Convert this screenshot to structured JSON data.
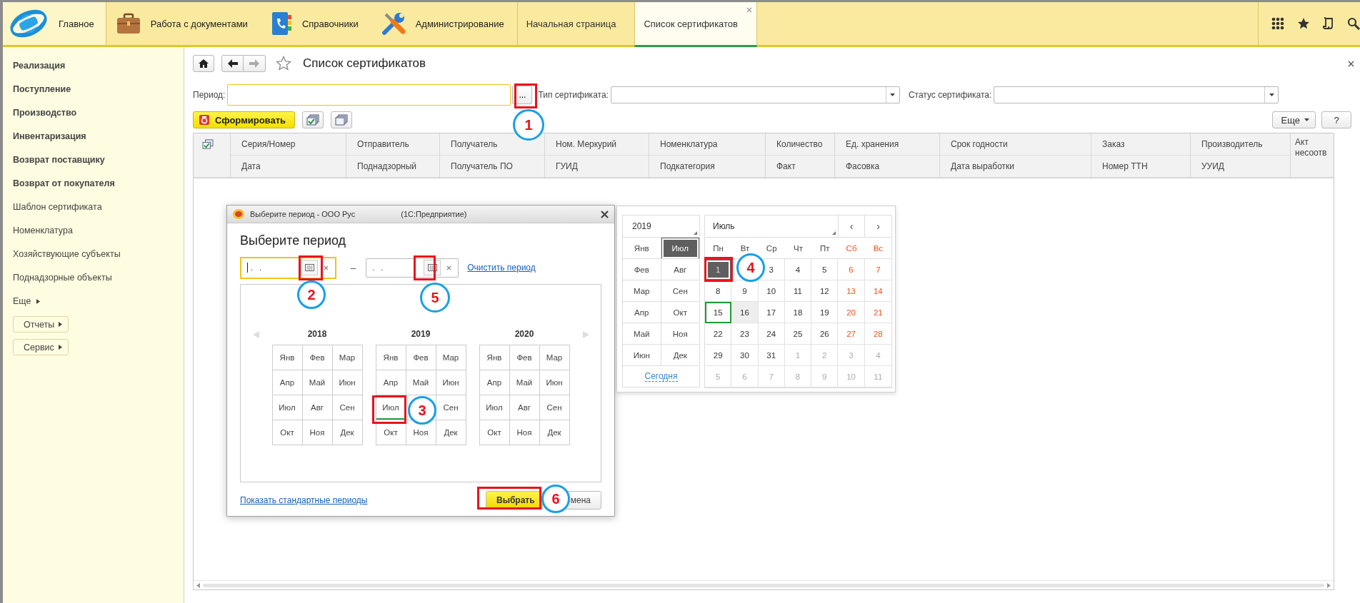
{
  "sections": [
    {
      "label": "Главное",
      "kind": "logo",
      "selected": true
    },
    {
      "label": "Работа с документами",
      "kind": "briefcase",
      "selected": false
    },
    {
      "label": "Справочники",
      "kind": "phonebook",
      "selected": false
    },
    {
      "label": "Администрирование",
      "kind": "tools",
      "selected": false
    }
  ],
  "open_tabs": [
    {
      "label": "Начальная страница",
      "selected": false,
      "closable": false
    },
    {
      "label": "Список сертификатов",
      "selected": true,
      "closable": true
    }
  ],
  "sidebar": {
    "items": [
      {
        "label": "Реализация",
        "bold": true
      },
      {
        "label": "Поступление",
        "bold": true
      },
      {
        "label": "Производство",
        "bold": true
      },
      {
        "label": "Инвентаризация",
        "bold": true
      },
      {
        "label": "Возврат поставщику",
        "bold": true
      },
      {
        "label": "Возврат от покупателя",
        "bold": true
      },
      {
        "label": "Шаблон сертификата",
        "bold": false
      },
      {
        "label": "Номенклатура",
        "bold": false
      },
      {
        "label": "Хозяйствующие субъекты",
        "bold": false
      },
      {
        "label": "Поднадзорные объекты",
        "bold": false
      }
    ],
    "more": "Еще",
    "buttons": [
      "Отчеты",
      "Сервис"
    ]
  },
  "page": {
    "title": "Список сертификатов",
    "filters": [
      {
        "label": "Период:",
        "kind": "period",
        "focused": true,
        "button": "..."
      },
      {
        "label": "Тип сертификата:",
        "kind": "dropdown",
        "focused": false
      },
      {
        "label": "Статус сертификата:",
        "kind": "dropdown",
        "focused": false
      }
    ],
    "generate": "Сформировать",
    "more": "Еще",
    "help": "?",
    "columns": [
      {
        "top": "Серия/Номер",
        "bottom": "Дата"
      },
      {
        "top": "Отправитель",
        "bottom": "Поднадзорный"
      },
      {
        "top": "Получатель",
        "bottom": "Получатель ПО"
      },
      {
        "top": "Ном. Меркурий",
        "bottom": "ГУИД"
      },
      {
        "top": "Номенклатура",
        "bottom": "Подкатегория"
      },
      {
        "top": "Количество",
        "bottom": "Факт"
      },
      {
        "top": "Ед. хранения",
        "bottom": "Фасовка"
      },
      {
        "top": "Срок годности",
        "bottom": "Дата выработки"
      },
      {
        "top": "Заказ",
        "bottom": "Номер ТТН"
      },
      {
        "top": "Производитель",
        "bottom": "УУИД"
      },
      {
        "top": "Акт несоотв"
      }
    ]
  },
  "period_dialog": {
    "window_title": "Выберите период - ООО Рус",
    "app_name": "(1С:Предприятие)",
    "heading": "Выберите период",
    "fields": [
      {
        "value": ". .",
        "focused": true
      },
      {
        "value": ". .",
        "focused": false
      }
    ],
    "dash": "–",
    "clear_link": "Очистить период",
    "years": [
      {
        "year": "2018",
        "months": [
          {
            "label": "Янв",
            "current": false
          },
          {
            "label": "Фев",
            "current": false
          },
          {
            "label": "Мар",
            "current": false
          },
          {
            "label": "Апр",
            "current": false
          },
          {
            "label": "Май",
            "current": false
          },
          {
            "label": "Июн",
            "current": false
          },
          {
            "label": "Июл",
            "current": false
          },
          {
            "label": "Авг",
            "current": false
          },
          {
            "label": "Сен",
            "current": false
          },
          {
            "label": "Окт",
            "current": false
          },
          {
            "label": "Ноя",
            "current": false
          },
          {
            "label": "Дек",
            "current": false
          }
        ]
      },
      {
        "year": "2019",
        "months": [
          {
            "label": "Янв",
            "current": false
          },
          {
            "label": "Фев",
            "current": false
          },
          {
            "label": "Мар",
            "current": false
          },
          {
            "label": "Апр",
            "current": false
          },
          {
            "label": "Май",
            "current": false
          },
          {
            "label": "Июн",
            "current": false
          },
          {
            "label": "Июл",
            "current": true
          },
          {
            "current": false
          },
          {
            "label": "Сен",
            "current": false
          },
          {
            "label": "Окт",
            "current": false
          },
          {
            "label": "Ноя",
            "current": false
          },
          {
            "label": "Дек",
            "current": false
          }
        ]
      },
      {
        "year": "2020",
        "months": [
          {
            "label": "Янв",
            "current": false
          },
          {
            "label": "Фев",
            "current": false
          },
          {
            "label": "Мар",
            "current": false
          },
          {
            "label": "Апр",
            "current": false
          },
          {
            "label": "Май",
            "current": false
          },
          {
            "label": "Июн",
            "current": false
          },
          {
            "label": "Июл",
            "current": false
          },
          {
            "label": "Авг",
            "current": false
          },
          {
            "label": "Сен",
            "current": false
          },
          {
            "label": "Окт",
            "current": false
          },
          {
            "label": "Ноя",
            "current": false
          },
          {
            "label": "Дек",
            "current": false
          }
        ]
      }
    ],
    "standard_link": "Показать стандартные периоды",
    "buttons": [
      {
        "label": "Выбрать",
        "kind": "primary"
      },
      {
        "label": "мена",
        "kind": "secondary"
      }
    ]
  },
  "calendar": {
    "year": "2019",
    "months": [
      {
        "label": "Янв",
        "selected": false
      },
      {
        "label": "Июл",
        "selected": true
      },
      {
        "label": "Фев",
        "selected": false
      },
      {
        "label": "Авг",
        "selected": false
      },
      {
        "label": "Мар",
        "selected": false
      },
      {
        "label": "Сен",
        "selected": false
      },
      {
        "label": "Апр",
        "selected": false
      },
      {
        "label": "Окт",
        "selected": false
      },
      {
        "label": "Май",
        "selected": false
      },
      {
        "label": "Ноя",
        "selected": false
      },
      {
        "label": "Июн",
        "selected": false
      },
      {
        "label": "Дек",
        "selected": false
      }
    ],
    "today_link": "Сегодня",
    "month": "Июль",
    "prev": "‹",
    "next": "›",
    "weekdays": [
      {
        "label": "Пн",
        "weekend": false
      },
      {
        "label": "Вт",
        "weekend": false
      },
      {
        "label": "Ср",
        "weekend": false
      },
      {
        "label": "Чт",
        "weekend": false
      },
      {
        "label": "Пт",
        "weekend": false
      },
      {
        "label": "Сб",
        "weekend": true
      },
      {
        "label": "Вс",
        "weekend": true
      }
    ],
    "days": [
      {
        "label": "1",
        "kind": "weekday",
        "selected": true,
        "today": false,
        "highlighted": false
      },
      {
        "kind": "weekday",
        "selected": false,
        "today": false,
        "highlighted": false
      },
      {
        "label": "3",
        "kind": "weekday",
        "selected": false,
        "today": false,
        "highlighted": false
      },
      {
        "label": "4",
        "kind": "weekday",
        "selected": false,
        "today": false,
        "highlighted": false
      },
      {
        "label": "5",
        "kind": "weekday",
        "selected": false,
        "today": false,
        "highlighted": false
      },
      {
        "label": "6",
        "kind": "weekend",
        "selected": false,
        "today": false,
        "highlighted": false
      },
      {
        "label": "7",
        "kind": "weekend",
        "selected": false,
        "today": false,
        "highlighted": false
      },
      {
        "label": "8",
        "kind": "weekday",
        "selected": false,
        "today": false,
        "highlighted": false
      },
      {
        "label": "9",
        "kind": "weekday",
        "selected": false,
        "today": false,
        "highlighted": false
      },
      {
        "label": "10",
        "kind": "weekday",
        "selected": false,
        "today": false,
        "highlighted": false
      },
      {
        "label": "11",
        "kind": "weekday",
        "selected": false,
        "today": false,
        "highlighted": false
      },
      {
        "label": "12",
        "kind": "weekday",
        "selected": false,
        "today": false,
        "highlighted": false
      },
      {
        "label": "13",
        "kind": "weekend",
        "selected": false,
        "today": false,
        "highlighted": false
      },
      {
        "label": "14",
        "kind": "weekend",
        "selected": false,
        "today": false,
        "highlighted": false
      },
      {
        "label": "15",
        "kind": "weekday",
        "selected": false,
        "today": true,
        "highlighted": false
      },
      {
        "label": "16",
        "kind": "weekday",
        "selected": false,
        "today": false,
        "highlighted": true
      },
      {
        "label": "17",
        "kind": "weekday",
        "selected": false,
        "today": false,
        "highlighted": false
      },
      {
        "label": "18",
        "kind": "weekday",
        "selected": false,
        "today": false,
        "highlighted": false
      },
      {
        "label": "19",
        "kind": "weekday",
        "selected": false,
        "today": false,
        "highlighted": false
      },
      {
        "label": "20",
        "kind": "weekend",
        "selected": false,
        "today": false,
        "highlighted": false
      },
      {
        "label": "21",
        "kind": "weekend",
        "selected": false,
        "today": false,
        "highlighted": false
      },
      {
        "label": "22",
        "kind": "weekday",
        "selected": false,
        "today": false,
        "highlighted": false
      },
      {
        "label": "23",
        "kind": "weekday",
        "selected": false,
        "today": false,
        "highlighted": false
      },
      {
        "label": "24",
        "kind": "weekday",
        "selected": false,
        "today": false,
        "highlighted": false
      },
      {
        "label": "25",
        "kind": "weekday",
        "selected": false,
        "today": false,
        "highlighted": false
      },
      {
        "label": "26",
        "kind": "weekday",
        "selected": false,
        "today": false,
        "highlighted": false
      },
      {
        "label": "27",
        "kind": "weekend",
        "selected": false,
        "today": false,
        "highlighted": false
      },
      {
        "label": "28",
        "kind": "weekend",
        "selected": false,
        "today": false,
        "highlighted": false
      },
      {
        "label": "29",
        "kind": "weekday",
        "selected": false,
        "today": false,
        "highlighted": false
      },
      {
        "label": "30",
        "kind": "weekday",
        "selected": false,
        "today": false,
        "highlighted": false
      },
      {
        "label": "31",
        "kind": "weekday",
        "selected": false,
        "today": false,
        "highlighted": false
      },
      {
        "label": "1",
        "kind": "other",
        "selected": false,
        "today": false,
        "highlighted": false
      },
      {
        "label": "2",
        "kind": "other",
        "selected": false,
        "today": false,
        "highlighted": false
      },
      {
        "label": "3",
        "kind": "other",
        "selected": false,
        "today": false,
        "highlighted": false
      },
      {
        "label": "4",
        "kind": "other",
        "selected": false,
        "today": false,
        "highlighted": false
      },
      {
        "label": "5",
        "kind": "other",
        "selected": false,
        "today": false,
        "highlighted": false
      },
      {
        "label": "6",
        "kind": "other",
        "selected": false,
        "today": false,
        "highlighted": false
      },
      {
        "label": "7",
        "kind": "other",
        "selected": false,
        "today": false,
        "highlighted": false
      },
      {
        "label": "8",
        "kind": "other",
        "selected": false,
        "today": false,
        "highlighted": false
      },
      {
        "label": "9",
        "kind": "other",
        "selected": false,
        "today": false,
        "highlighted": false
      },
      {
        "label": "10",
        "kind": "other",
        "selected": false,
        "today": false,
        "highlighted": false
      },
      {
        "label": "11",
        "kind": "other",
        "selected": false,
        "today": false,
        "highlighted": false
      }
    ]
  },
  "annotations": [
    {
      "number": "1"
    },
    {
      "number": "2"
    },
    {
      "number": "3"
    },
    {
      "number": "4"
    },
    {
      "number": "5"
    },
    {
      "number": "6"
    }
  ]
}
